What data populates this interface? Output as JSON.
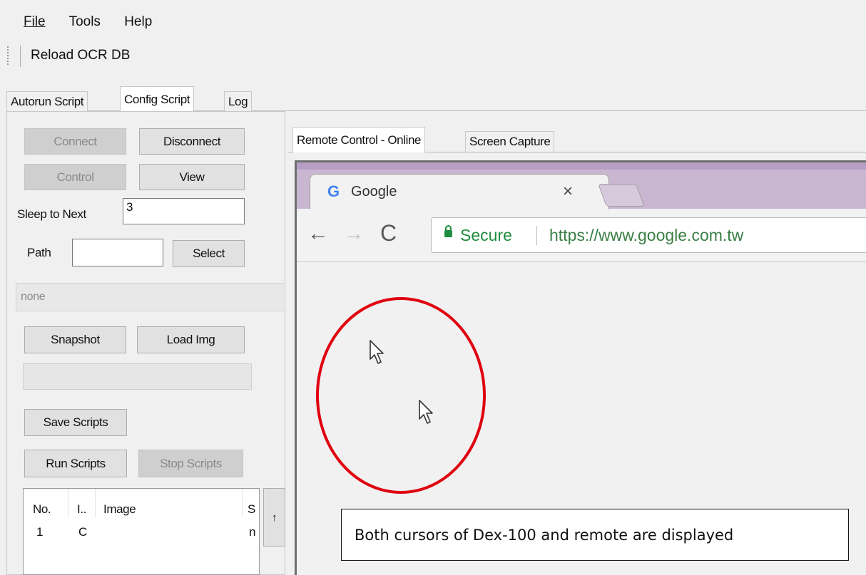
{
  "menu": {
    "file": "File",
    "tools": "Tools",
    "help": "Help"
  },
  "toolbar": {
    "reload_ocr_db": "Reload OCR DB"
  },
  "tabs": {
    "autorun": "Autorun Script",
    "config": "Config Script",
    "log": "Log"
  },
  "controls": {
    "connect": "Connect",
    "disconnect": "Disconnect",
    "control": "Control",
    "view": "View",
    "sleep_label": "Sleep to Next",
    "sleep_value": "3",
    "path_label": "Path",
    "path_value": "",
    "select": "Select",
    "status_text": "none",
    "snapshot": "Snapshot",
    "load_img": "Load Img",
    "save_scripts": "Save Scripts",
    "run_scripts": "Run Scripts",
    "stop_scripts": "Stop Scripts",
    "scroll_up": "↑"
  },
  "script_table": {
    "headers": [
      "No.",
      "I..",
      "Image",
      "S"
    ],
    "rows": [
      [
        "1",
        "C",
        "",
        "n"
      ]
    ]
  },
  "remote_tabs": {
    "remote_control": "Remote Control - Online",
    "screen_capture": "Screen Capture"
  },
  "browser": {
    "tab_title": "Google",
    "tab_close": "×",
    "secure": "Secure",
    "url": "https://www.google.com.tw"
  },
  "annotation": "Both cursors of Dex-100 and remote are displayed",
  "colors": {
    "annotation_red": "#e0000f",
    "secure_green": "#1e8e3e",
    "browser_frame": "#c9b7d2"
  }
}
